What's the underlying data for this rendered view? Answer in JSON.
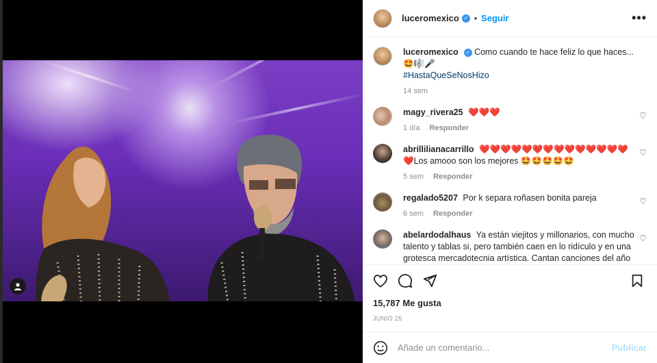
{
  "header": {
    "username": "luceromexico",
    "follow_label": "Seguir",
    "more_label": "•••"
  },
  "caption": {
    "username": "luceromexico",
    "text": "Como cuando te hace feliz lo que haces... 🤩🎼🎤",
    "hashtag": "#HastaQueSeNosHizo",
    "time": "14 sem"
  },
  "comments": [
    {
      "username": "magy_rivera25",
      "text": "❤️❤️❤️",
      "time": "1 día",
      "reply": "Responder"
    },
    {
      "username": "abrillilianacarrillo",
      "text": "❤️❤️❤️❤️❤️❤️❤️❤️❤️❤️❤️❤️❤️❤️❤️Los amooo son los mejores 🤩🤩🤩🤩🤩",
      "time": "5 sem",
      "reply": "Responder"
    },
    {
      "username": "regalado5207",
      "text": "Por k separa roñasen bonita pareja",
      "time": "6 sem",
      "reply": "Responder"
    },
    {
      "username": "abelardodalhaus",
      "text": "Ya están viejitos y millonarios, con mucho talento y tablas si, pero también caen en lo ridículo y en una grotesca mercadotecnia artística. Cantan canciones del año del",
      "time": "",
      "reply": ""
    }
  ],
  "post": {
    "likes": "15,787 Me gusta",
    "date": "JUNIO 25"
  },
  "comment_box": {
    "placeholder": "Añade un comentario...",
    "publish_label": "Publicar"
  },
  "colors": {
    "accent": "#0095f6",
    "verified": "#3897f0",
    "publish_disabled": "#b2dffc"
  }
}
